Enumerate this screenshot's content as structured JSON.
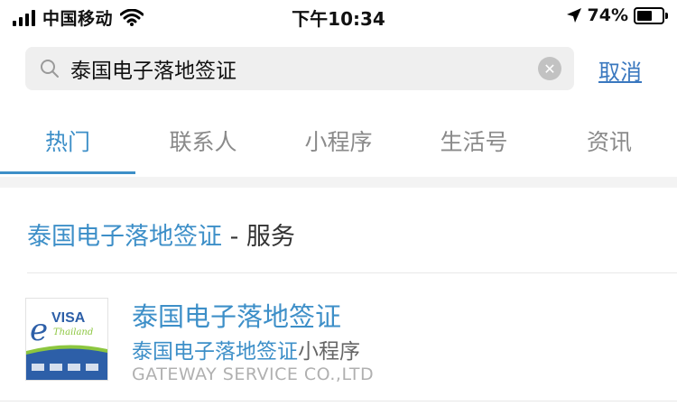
{
  "status_bar": {
    "carrier": "中国移动",
    "time": "下午10:34",
    "battery_percent": "74%",
    "battery_level": 0.74,
    "icons": [
      "cellular-signal-icon",
      "wifi-icon",
      "location-arrow-icon",
      "battery-icon"
    ]
  },
  "search": {
    "query": "泰国电子落地签证",
    "cancel_label": "取消",
    "icons": [
      "search-icon",
      "clear-icon"
    ]
  },
  "tabs": [
    {
      "label": "热门",
      "active": true
    },
    {
      "label": "联系人",
      "active": false
    },
    {
      "label": "小程序",
      "active": false
    },
    {
      "label": "生活号",
      "active": false
    },
    {
      "label": "资讯",
      "active": false
    }
  ],
  "section": {
    "title_highlight": "泰国电子落地签证",
    "title_suffix": " - 服务"
  },
  "result": {
    "title": "泰国电子落地签证",
    "subtitle_highlight": "泰国电子落地签证",
    "subtitle_suffix": "小程序",
    "company": "GATEWAY SERVICE CO.,LTD",
    "thumbnail": {
      "text_main": "VISA",
      "text_script": "Thailand",
      "logo_initial": "e"
    }
  },
  "colors": {
    "accent": "#3d8fc8",
    "link": "#3a78bf",
    "tab_inactive": "#8a8a8a",
    "search_bg": "#efefef"
  }
}
